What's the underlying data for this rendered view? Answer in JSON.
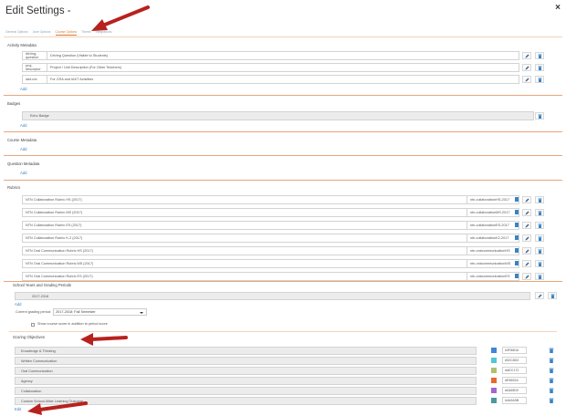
{
  "header": {
    "title": "Edit Settings -",
    "close": "×"
  },
  "tabs": [
    {
      "label": "General Options"
    },
    {
      "label": "User Options"
    },
    {
      "label": "Course Options"
    },
    {
      "label": "Theme"
    },
    {
      "label": "Integrations"
    }
  ],
  "activity_metadata": {
    "title": "Activity Metadata",
    "rows": [
      {
        "key": "driving-question",
        "value": "Driving Question (Visible to Students)"
      },
      {
        "key": "proj-descriptor",
        "value": "Project / Unit Description (For Other Teachers)"
      },
      {
        "key": "iakt-cra",
        "value": "For CRA and IAKT Activities"
      }
    ],
    "add": "Add"
  },
  "badges": {
    "title": "Badges",
    "rows": [
      {
        "value": "Echo Badge"
      }
    ],
    "add": "Add"
  },
  "course_metadata": {
    "title": "Course Metadata",
    "add": "Add"
  },
  "question_metadata": {
    "title": "Question Metadata",
    "add": "Add"
  },
  "rubrics": {
    "title": "Rubrics",
    "rows": [
      {
        "name": "NTN Collaboration Rubric HS (2017)",
        "code": "ntn-collaborationHS-2017"
      },
      {
        "name": "NTN Collaboration Rubric MS (2017)",
        "code": "ntn-collaborationMS-2017"
      },
      {
        "name": "NTN Collaboration Rubric ES (2017)",
        "code": "ntn-collaborationES-2017"
      },
      {
        "name": "NTN Collaboration Rubric K-2 (2017)",
        "code": "ntn-collaborationK2-2017"
      },
      {
        "name": "NTN Oral Communication Rubric HS (2017)",
        "code": "ntn-oralcommunicationHS"
      },
      {
        "name": "NTN Oral Communication Rubric MS (2017)",
        "code": "ntn-oralcommunicationMS"
      },
      {
        "name": "NTN Oral Communication Rubric ES (2017)",
        "code": "ntn-oralcommunicationES"
      }
    ]
  },
  "school_years": {
    "title": "School Years and Grading Periods",
    "rows": [
      {
        "value": "2017-2018"
      }
    ],
    "add": "Add",
    "current_label": "Current grading period:",
    "current_value": "2017-2018: Fall Semester",
    "checkbox_label": "Show course score in addition to period score"
  },
  "scoring": {
    "title": "Scoring Objectives",
    "rows": [
      {
        "name": "Knowledge & Thinking",
        "color": "#3F86DA",
        "hex": "#3F86DA"
      },
      {
        "name": "Written Communication",
        "color": "#52C8D3",
        "hex": "#52C8D3"
      },
      {
        "name": "Oral Communication",
        "color": "#AEC172",
        "hex": "#AEC172"
      },
      {
        "name": "Agency",
        "color": "#E9692A",
        "hex": "#E9692A"
      },
      {
        "name": "Collaboration",
        "color": "#A465D0",
        "hex": "#A465D0"
      },
      {
        "name": "Custom School-Wide Learning Outcome",
        "color": "#4A9A9B",
        "hex": "#4A9A9B"
      }
    ],
    "add": "Edit"
  },
  "colors": {
    "accent": "#d67832",
    "link": "#3a84c4",
    "arrow": "#b7221d",
    "divider": "#e6a77d"
  }
}
